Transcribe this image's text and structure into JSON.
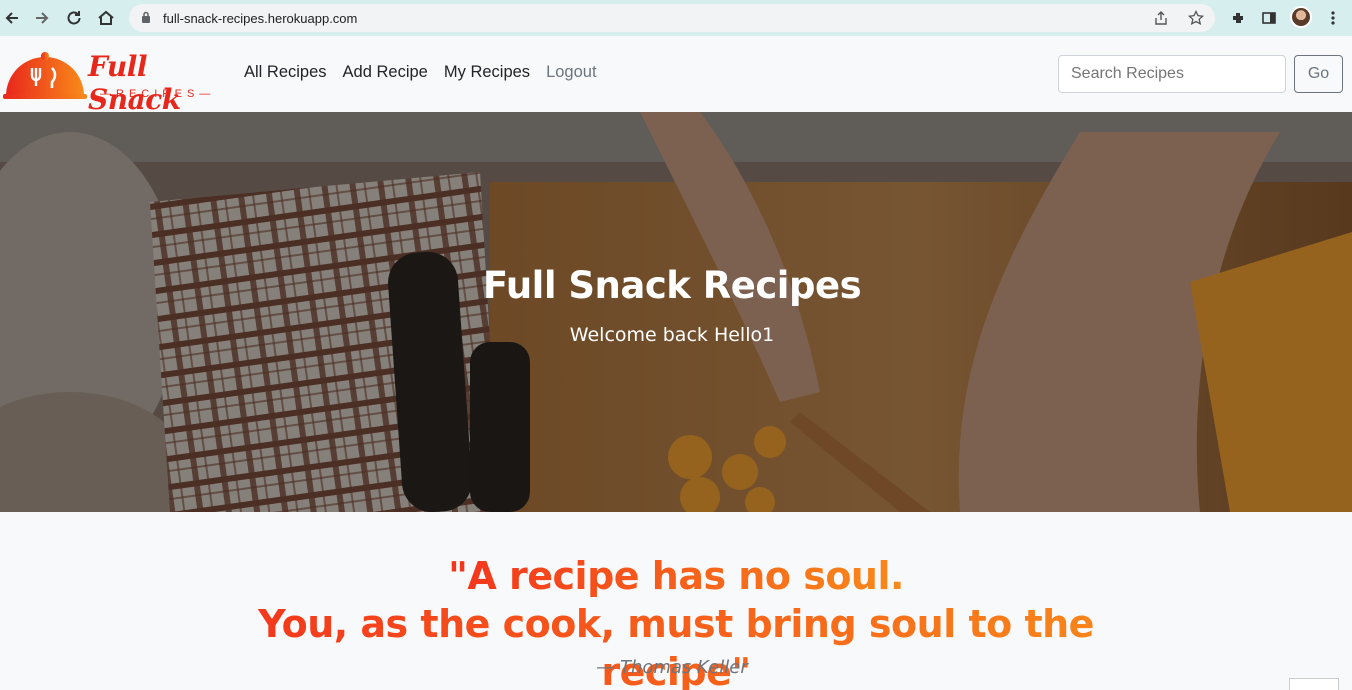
{
  "browser": {
    "url": "full-snack-recipes.herokuapp.com"
  },
  "brand": {
    "name": "Full Snack",
    "tagline": "—RECIPES—"
  },
  "nav": {
    "links": [
      "All Recipes",
      "Add Recipe",
      "My Recipes",
      "Logout"
    ]
  },
  "search": {
    "placeholder": "Search Recipes",
    "button_label": "Go"
  },
  "hero": {
    "title": "Full Snack Recipes",
    "subtitle": "Welcome back Hello1"
  },
  "quote": {
    "line1": "\"A recipe has no soul.",
    "line2": "You, as the cook, must bring soul to the recipe\"",
    "author": "— Thomas Keller"
  },
  "colors": {
    "brand_red": "#e8271c",
    "quote_start": "#f4331c",
    "quote_end": "#f98a1a"
  }
}
